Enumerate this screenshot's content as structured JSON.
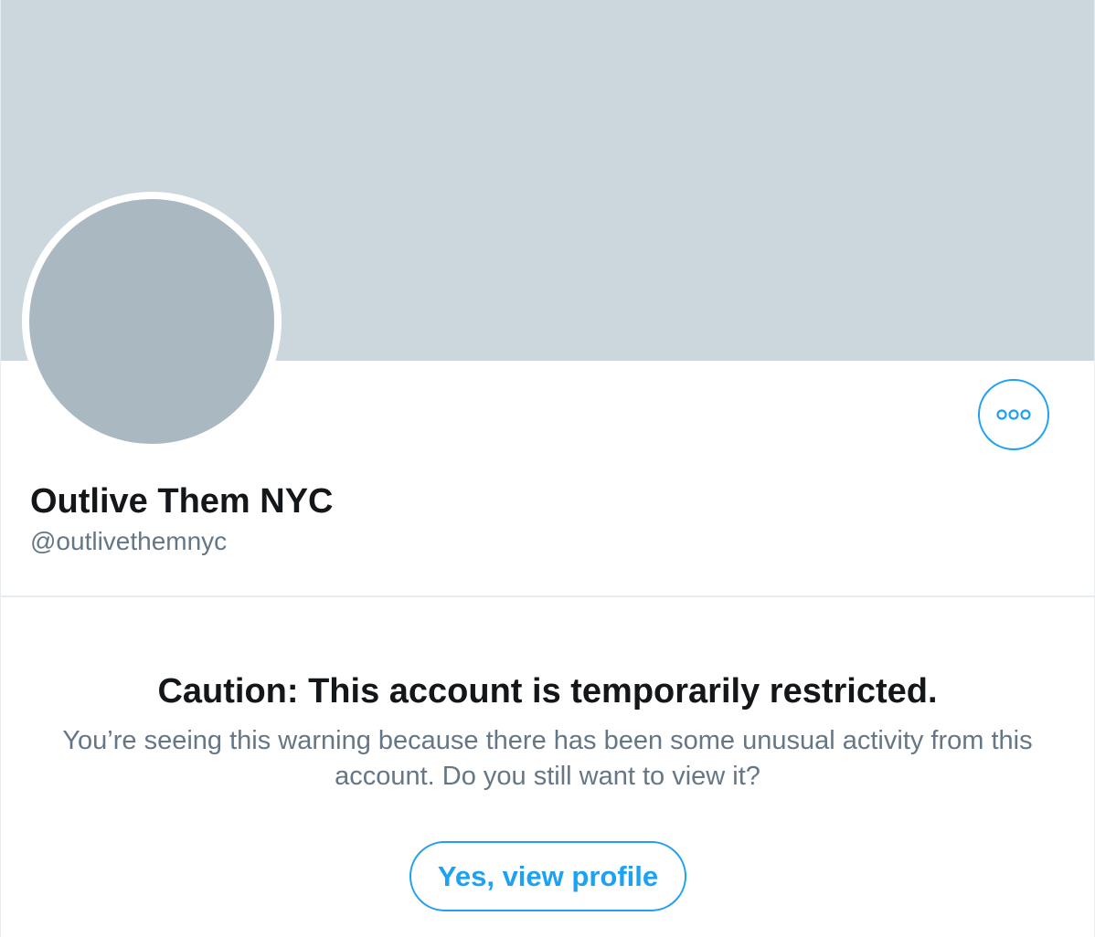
{
  "profile": {
    "display_name": "Outlive Them NYC",
    "handle": "@outlivethemnyc"
  },
  "actions": {
    "more_icon": "more-horizontal-icon"
  },
  "warning": {
    "title": "Caution: This account is temporarily restricted.",
    "message": "You’re seeing this warning because there has been some unusual activity from this account. Do you still want to view it?",
    "button_label": "Yes, view profile"
  },
  "colors": {
    "accent": "#1da1f2",
    "banner": "#ccd6dd",
    "avatar_placeholder": "#aab8c2",
    "primary_text": "#14171a",
    "secondary_text": "#657786"
  }
}
